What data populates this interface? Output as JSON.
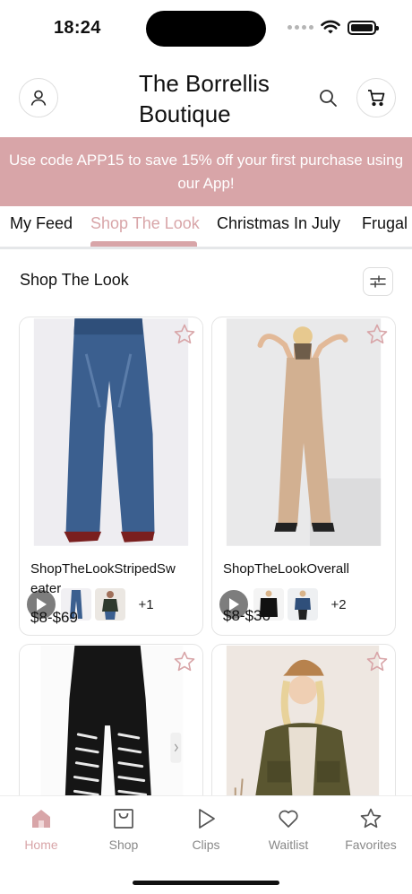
{
  "status_bar": {
    "time": "18:24"
  },
  "header": {
    "title": "The Borrellis Boutique"
  },
  "promo": {
    "text": "Use code APP15 to save 15% off your first purchase using our App!"
  },
  "tabs": [
    {
      "label": "My Feed",
      "active": false
    },
    {
      "label": "Shop The Look",
      "active": true
    },
    {
      "label": "Christmas In July",
      "active": false
    },
    {
      "label": "Frugal F",
      "active": false
    }
  ],
  "section": {
    "title": "Shop The Look"
  },
  "products": [
    {
      "name": "ShopTheLookStripedSweater",
      "price": "$8-$69",
      "extra_count": "+1"
    },
    {
      "name": "ShopTheLookOverall",
      "price": "$8-$36",
      "extra_count": "+2"
    }
  ],
  "bottom_nav": [
    {
      "label": "Home",
      "icon": "home-icon",
      "active": true
    },
    {
      "label": "Shop",
      "icon": "shop-bag-icon",
      "active": false
    },
    {
      "label": "Clips",
      "icon": "play-icon",
      "active": false
    },
    {
      "label": "Waitlist",
      "icon": "heart-icon",
      "active": false
    },
    {
      "label": "Favorites",
      "icon": "star-icon",
      "active": false
    }
  ],
  "colors": {
    "accent": "#d8a5a8",
    "text": "#111111",
    "muted": "#888888"
  }
}
